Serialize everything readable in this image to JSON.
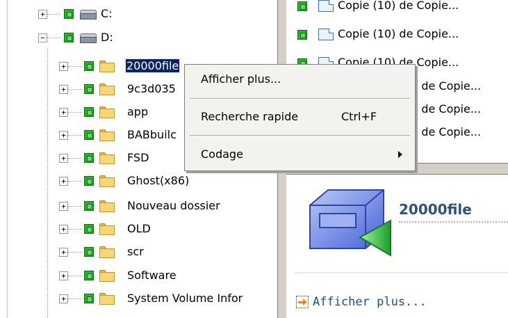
{
  "tree": {
    "drives": [
      {
        "label": "C:"
      },
      {
        "label": "D:"
      }
    ],
    "folders": [
      {
        "label": "20000file"
      },
      {
        "label": "9c3d035"
      },
      {
        "label": "app"
      },
      {
        "label": "BABbuilc"
      },
      {
        "label": "FSD"
      },
      {
        "label": "Ghost(x86)"
      },
      {
        "label": "Nouveau dossier"
      },
      {
        "label": "OLD"
      },
      {
        "label": "scr"
      },
      {
        "label": "Software"
      },
      {
        "label": "System Volume Infor"
      }
    ],
    "expander_plus": "+",
    "expander_minus": "−"
  },
  "file_list": {
    "rows": [
      {
        "label": "Copie (10) de Copie..."
      },
      {
        "label": "Copie (10) de Copie..."
      },
      {
        "label": "Copie (10) de Copie..."
      },
      {
        "label": ") de Copie..."
      },
      {
        "label": ") de Copie..."
      },
      {
        "label": ") de Copie..."
      }
    ]
  },
  "details": {
    "title": "20000file",
    "link_text": "Afficher plus..."
  },
  "context_menu": {
    "items": [
      {
        "label": "Afficher plus...",
        "shortcut": ""
      },
      {
        "label": "Recherche rapide",
        "shortcut": "Ctrl+F"
      },
      {
        "label": "Codage",
        "shortcut": ""
      }
    ]
  },
  "colors": {
    "selection": "#0a246a",
    "check_green": "#27b32a",
    "title_blue": "#2c5479",
    "arrow_orange": "#f08c00"
  }
}
